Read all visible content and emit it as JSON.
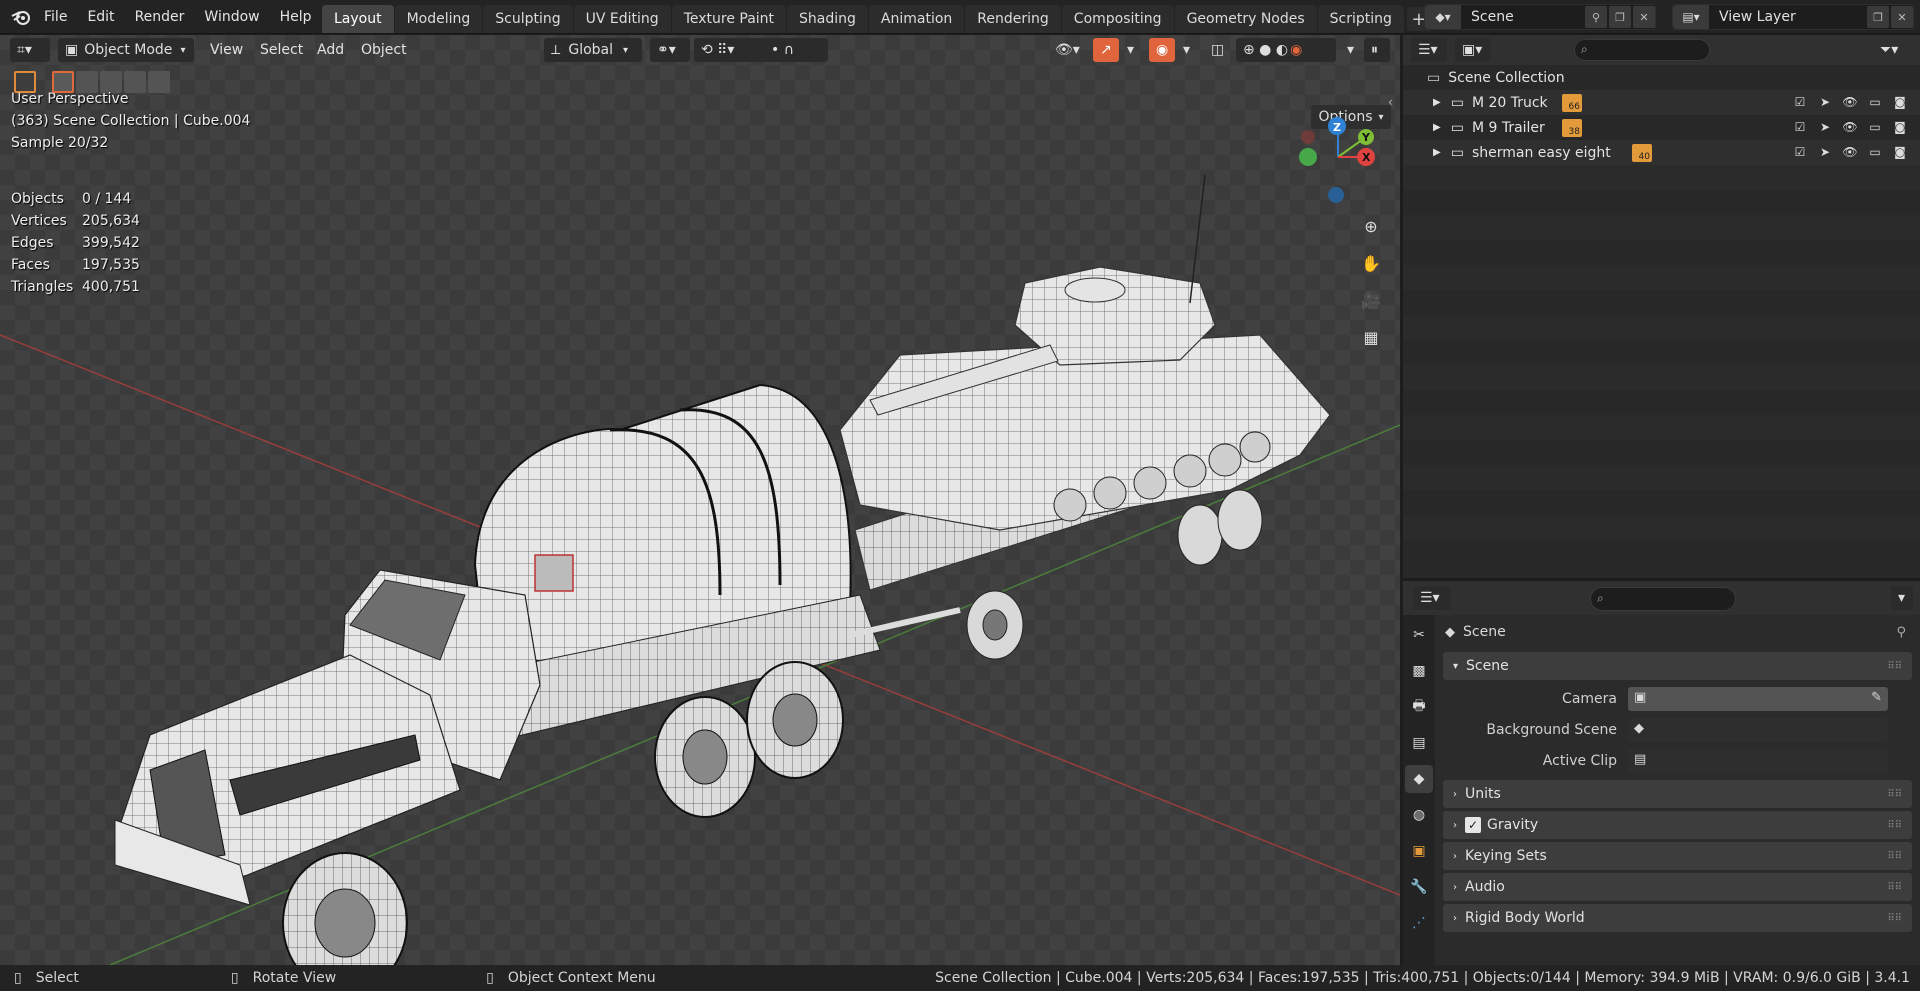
{
  "app": {
    "menu": [
      "File",
      "Edit",
      "Render",
      "Window",
      "Help"
    ],
    "workspaces": [
      "Layout",
      "Modeling",
      "Sculpting",
      "UV Editing",
      "Texture Paint",
      "Shading",
      "Animation",
      "Rendering",
      "Compositing",
      "Geometry Nodes",
      "Scripting"
    ],
    "active_workspace": "Layout",
    "scene_name": "Scene",
    "view_layer": "View Layer"
  },
  "viewport": {
    "mode": "Object Mode",
    "menus": [
      "View",
      "Select",
      "Add",
      "Object"
    ],
    "transform_orientation": "Global",
    "options_label": "Options",
    "perspective_label": "User Perspective",
    "collection_info": "(363) Scene Collection | Cube.004",
    "sample_info": "Sample 20/32",
    "stats": [
      {
        "label": "Objects",
        "value": "0 / 144"
      },
      {
        "label": "Vertices",
        "value": "205,634"
      },
      {
        "label": "Edges",
        "value": "399,542"
      },
      {
        "label": "Faces",
        "value": "197,535"
      },
      {
        "label": "Triangles",
        "value": "400,751"
      }
    ],
    "axis_labels": {
      "z": "Z",
      "y": "Y",
      "x": "X"
    },
    "colors": {
      "x_axis": "#e0433f",
      "y_axis": "#7ebd35",
      "z_axis": "#2e82d6",
      "accent": "#e0643c"
    }
  },
  "outliner": {
    "root": "Scene Collection",
    "collections": [
      {
        "name": "M 20 Truck",
        "count": "66"
      },
      {
        "name": "M 9 Trailer",
        "count": "38"
      },
      {
        "name": "sherman easy eight",
        "count": "40"
      }
    ]
  },
  "properties": {
    "context_label": "Scene",
    "scene_panel": "Scene",
    "fields": [
      {
        "label": "Camera"
      },
      {
        "label": "Background Scene"
      },
      {
        "label": "Active Clip"
      }
    ],
    "panels": [
      "Units",
      "Gravity",
      "Keying Sets",
      "Audio",
      "Rigid Body World"
    ]
  },
  "statusbar": {
    "select": "Select",
    "rotate": "Rotate View",
    "context_menu": "Object Context Menu",
    "info": "Scene Collection | Cube.004 | Verts:205,634 | Faces:197,535 | Tris:400,751 | Objects:0/144 | Memory: 394.9 MiB | VRAM: 0.9/6.0 GiB | 3.4.1"
  }
}
